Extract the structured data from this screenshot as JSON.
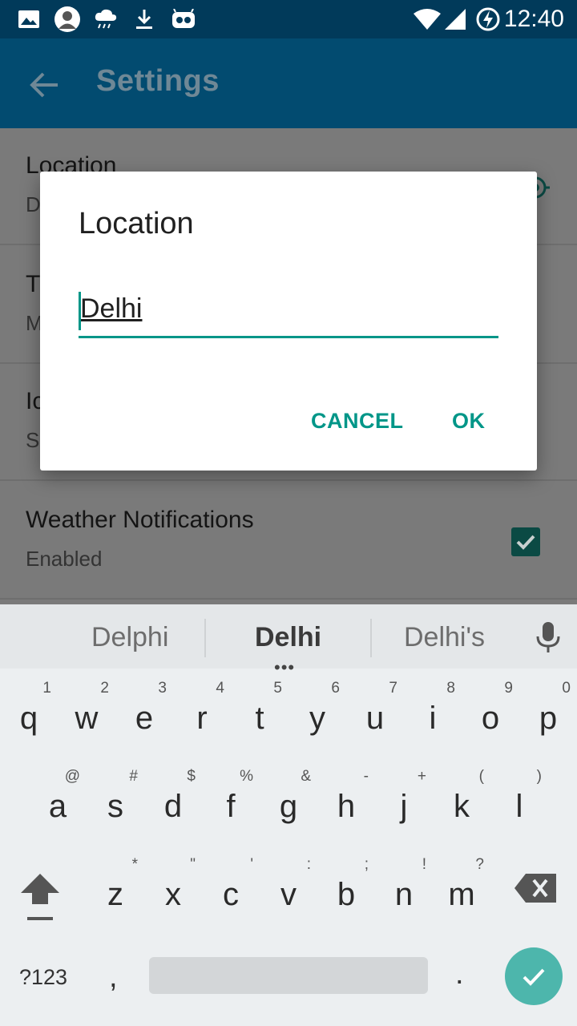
{
  "status_bar": {
    "time": "12:40",
    "icons": [
      "image-icon",
      "avatar-icon",
      "rain-cloud-icon",
      "download-icon",
      "cyanogen-icon",
      "wifi-icon",
      "signal-icon",
      "battery-charging-icon"
    ]
  },
  "app_bar": {
    "title": "Settings",
    "back_icon": "back-arrow-icon"
  },
  "settings": {
    "items": [
      {
        "title": "Location",
        "summary": "D",
        "trailing": "location-icon"
      },
      {
        "title": "T",
        "summary": "M"
      },
      {
        "title": "Ic",
        "summary": "S"
      },
      {
        "title": "Weather Notifications",
        "summary": "Enabled",
        "trailing": "checkbox-checked"
      }
    ]
  },
  "dialog": {
    "title": "Location",
    "input_value": "Delhi",
    "cancel_label": "CANCEL",
    "ok_label": "OK"
  },
  "keyboard": {
    "suggestions": [
      "Delphi",
      "Delhi",
      "Delhi's"
    ],
    "selected_suggestion": "Delhi",
    "suggestion_dots": "•••",
    "row1": [
      {
        "k": "q",
        "h": "1"
      },
      {
        "k": "w",
        "h": "2"
      },
      {
        "k": "e",
        "h": "3"
      },
      {
        "k": "r",
        "h": "4"
      },
      {
        "k": "t",
        "h": "5"
      },
      {
        "k": "y",
        "h": "6"
      },
      {
        "k": "u",
        "h": "7"
      },
      {
        "k": "i",
        "h": "8"
      },
      {
        "k": "o",
        "h": "9"
      },
      {
        "k": "p",
        "h": "0"
      }
    ],
    "row2": [
      {
        "k": "a",
        "h": "@"
      },
      {
        "k": "s",
        "h": "#"
      },
      {
        "k": "d",
        "h": "$"
      },
      {
        "k": "f",
        "h": "%"
      },
      {
        "k": "g",
        "h": "&"
      },
      {
        "k": "h",
        "h": "-"
      },
      {
        "k": "j",
        "h": "+"
      },
      {
        "k": "k",
        "h": "("
      },
      {
        "k": "l",
        "h": ")"
      }
    ],
    "row3": [
      {
        "k": "z",
        "h": "*"
      },
      {
        "k": "x",
        "h": "\""
      },
      {
        "k": "c",
        "h": "'"
      },
      {
        "k": "v",
        "h": ":"
      },
      {
        "k": "b",
        "h": ";"
      },
      {
        "k": "n",
        "h": "!"
      },
      {
        "k": "m",
        "h": "?"
      }
    ],
    "symbols_label": "?123",
    "comma_label": ",",
    "period_label": "."
  },
  "colors": {
    "status_bar": "#013a5a",
    "app_bar": "#024b70",
    "accent": "#009688",
    "enter_key": "#4db6ac"
  }
}
